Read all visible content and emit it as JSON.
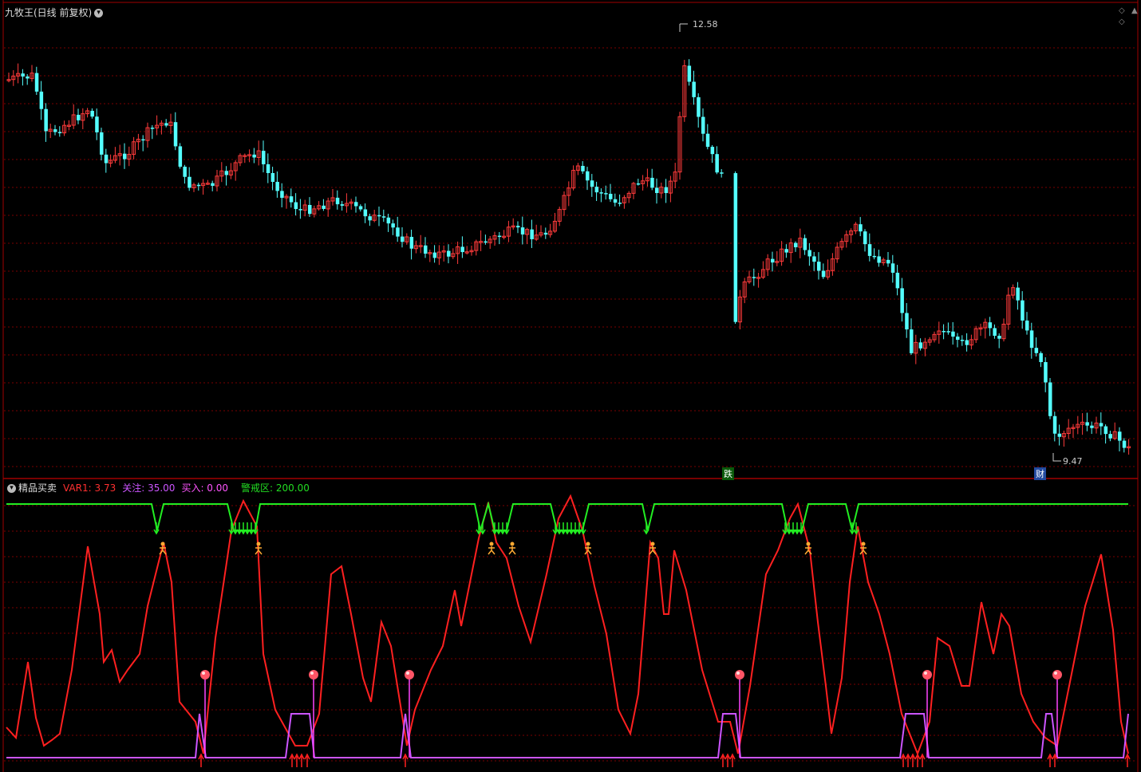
{
  "main_panel": {
    "title": "九牧王(日线 前复权)",
    "high_label": "12.58",
    "low_label": "9.47",
    "tag_die": "跌",
    "tag_cai": "财"
  },
  "indicator_panel": {
    "name": "精品买卖",
    "var1": "VAR1: 3.73",
    "guanzhu": "关注: 35.00",
    "mairu": "买入: 0.00",
    "jingjie": "警戒区: 200.00"
  },
  "colors": {
    "up": "#ff3b3b",
    "down": "#54ffff",
    "grid": "#7a0000",
    "border": "#a00000",
    "var1_line": "#ff2020",
    "guanzhu_line": "#cc55ff",
    "jingjie_line": "#22ee22"
  }
}
